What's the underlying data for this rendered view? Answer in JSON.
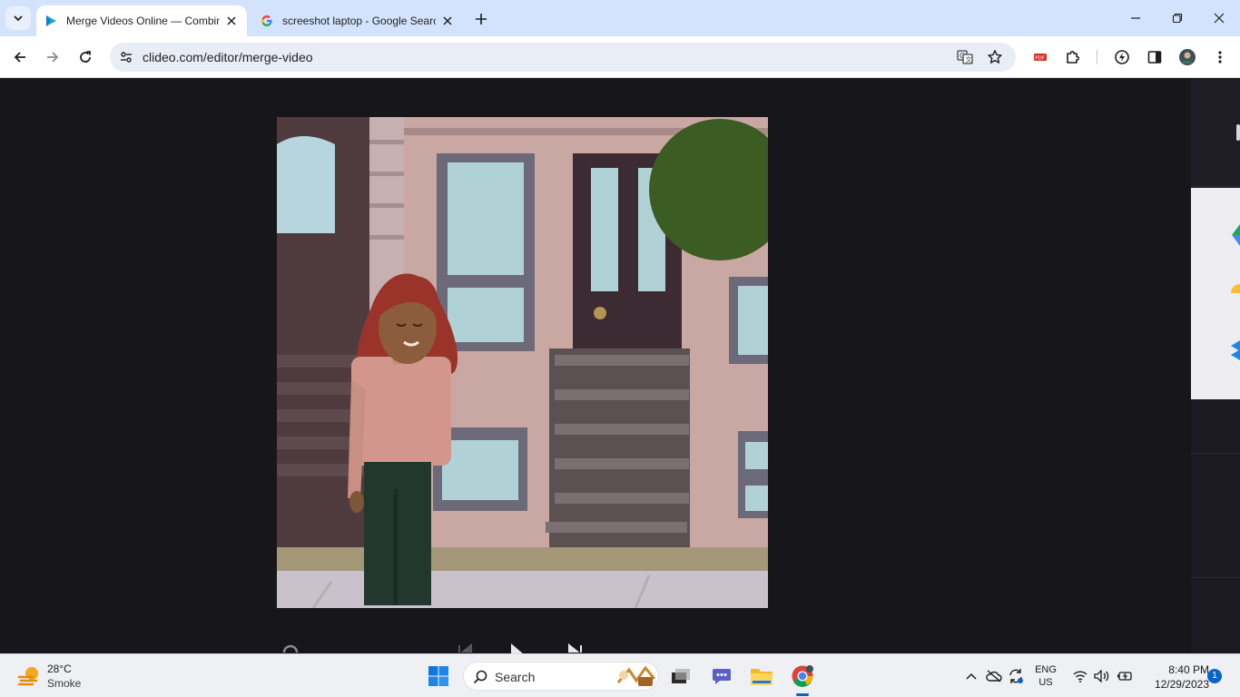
{
  "browser": {
    "tabs": [
      {
        "title": "Merge Videos Online — Combine",
        "favicon": "clideo-play-icon",
        "active": true
      },
      {
        "title": "screeshot laptop - Google Search",
        "favicon": "google-g-icon",
        "active": false
      }
    ],
    "url": "clideo.com/editor/merge-video",
    "accent": "#d3e3fd"
  },
  "taskbar": {
    "weather": {
      "temp": "28°C",
      "condition": "Smoke"
    },
    "search_label": "Search",
    "language": {
      "line1": "ENG",
      "line2": "US"
    },
    "clock": {
      "time": "8:40 PM",
      "date": "12/29/2023"
    },
    "notification_count": "1"
  }
}
